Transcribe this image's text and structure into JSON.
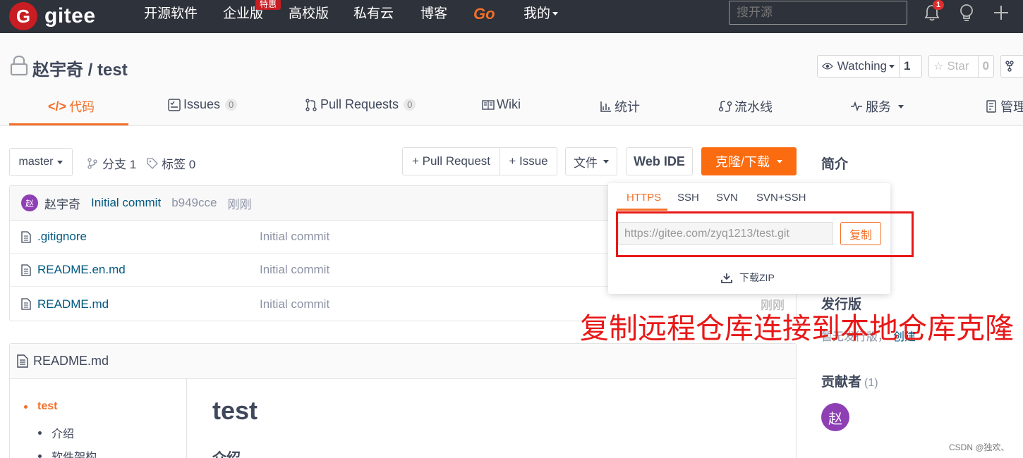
{
  "nav": {
    "logo_letter": "G",
    "logo_text": "gitee",
    "items": [
      "开源软件",
      "企业版",
      "高校版",
      "私有云",
      "博客",
      "Go",
      "我的"
    ],
    "promo_badge": "特惠",
    "search_placeholder": "搜开源",
    "notification_count": "1"
  },
  "repo": {
    "title": "赵宇奇 / test",
    "watching_label": "Watching",
    "watching_count": "1",
    "star_label": "Star",
    "star_count": "0"
  },
  "tabs": [
    {
      "label": "代码"
    },
    {
      "label": "Issues",
      "count": "0"
    },
    {
      "label": "Pull Requests",
      "count": "0"
    },
    {
      "label": "Wiki"
    },
    {
      "label": "统计"
    },
    {
      "label": "流水线"
    },
    {
      "label": "服务"
    },
    {
      "label": "管理"
    }
  ],
  "toolbar": {
    "branch": "master",
    "branches": "分支 1",
    "tags": "标签 0",
    "pull_request": "+ Pull Request",
    "issue": "+ Issue",
    "file": "文件",
    "web_ide": "Web IDE",
    "clone": "克隆/下载"
  },
  "commit": {
    "avatar": "赵",
    "author": "赵宇奇",
    "message": "Initial commit",
    "hash": "b949cce",
    "time": "刚刚"
  },
  "files": [
    {
      "name": ".gitignore",
      "message": "Initial commit",
      "time": ""
    },
    {
      "name": "README.en.md",
      "message": "Initial commit",
      "time": ""
    },
    {
      "name": "README.md",
      "message": "Initial commit",
      "time": "刚刚"
    }
  ],
  "readme": {
    "filename": "README.md",
    "toc": [
      "test",
      "介绍",
      "软件架构"
    ],
    "title": "test",
    "h2": "介绍"
  },
  "sidebar": {
    "intro": "简介",
    "release": "发行版",
    "release_text": "暂无发行版，",
    "release_link": "创建",
    "contributors": "贡献者",
    "contributors_count": "(1)",
    "contributor_avatar": "赵"
  },
  "clone_dropdown": {
    "tabs": [
      "HTTPS",
      "SSH",
      "SVN",
      "SVN+SSH"
    ],
    "url": "https://gitee.com/zyq1213/test.git",
    "copy": "复制",
    "download": "下载ZIP"
  },
  "annotation": "复制远程仓库连接到本地仓库克隆",
  "watermark": "CSDN @独欢、",
  "colors": {
    "nav_bg": "#2e323a",
    "accent": "#f36f27",
    "clone_button": "#fb6b10",
    "annotation_red": "#e81818",
    "link": "#005980",
    "avatar": "#8e3fb4"
  }
}
